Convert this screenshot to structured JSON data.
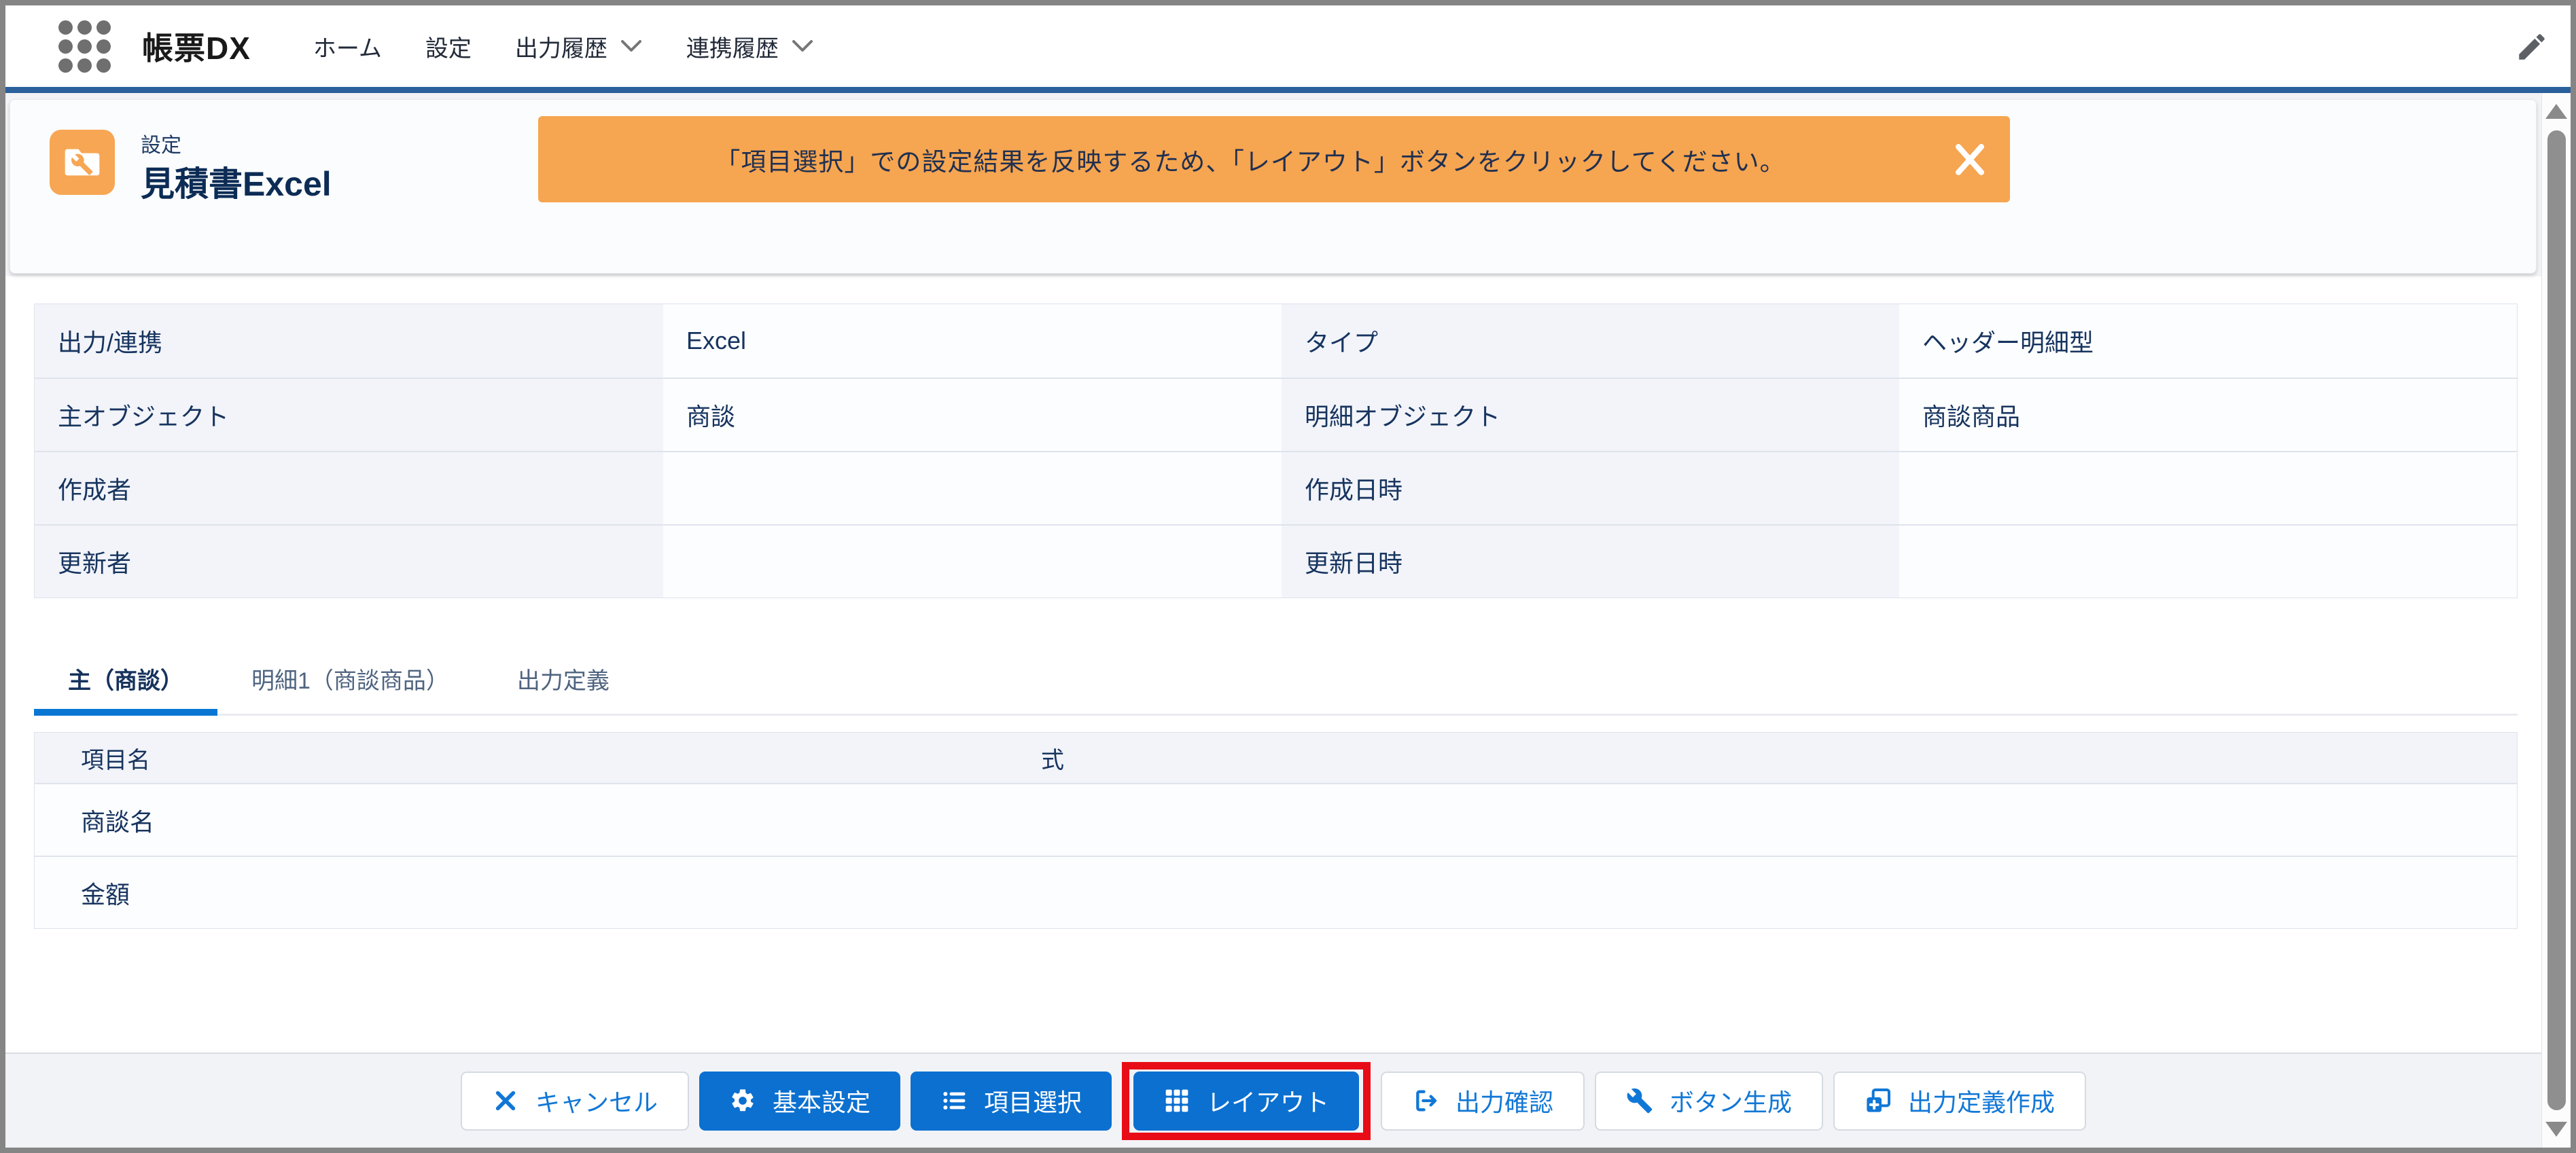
{
  "app_header": {
    "app_name": "帳票DX",
    "nav_items": [
      {
        "label": "ホーム",
        "has_menu": false
      },
      {
        "label": "設定",
        "has_menu": false
      },
      {
        "label": "出力履歴",
        "has_menu": true
      },
      {
        "label": "連携履歴",
        "has_menu": true
      }
    ]
  },
  "page_header": {
    "record_type_label": "設定",
    "title": "見積書Excel",
    "banner": {
      "message": "「項目選択」での設定結果を反映するため、「レイアウト」ボタンをクリックしてください。"
    }
  },
  "record_details": {
    "fields": [
      {
        "label": "出力/連携",
        "value": "Excel"
      },
      {
        "label": "タイプ",
        "value": "ヘッダー明細型"
      },
      {
        "label": "主オブジェクト",
        "value": "商談"
      },
      {
        "label": "明細オブジェクト",
        "value": "商談商品"
      },
      {
        "label": "作成者",
        "value": ""
      },
      {
        "label": "作成日時",
        "value": ""
      },
      {
        "label": "更新者",
        "value": ""
      },
      {
        "label": "更新日時",
        "value": ""
      }
    ]
  },
  "tabs": [
    {
      "label": "主（商談）",
      "active": true
    },
    {
      "label": "明細1（商談商品）",
      "active": false
    },
    {
      "label": "出力定義",
      "active": false
    }
  ],
  "field_table": {
    "columns": [
      "項目名",
      "式"
    ],
    "rows": [
      {
        "name": "商談名",
        "formula": ""
      },
      {
        "name": "金額",
        "formula": ""
      }
    ]
  },
  "footer": {
    "buttons": [
      {
        "label": "キャンセル",
        "variant": "neutral",
        "icon": "close-icon",
        "highlighted": false
      },
      {
        "label": "基本設定",
        "variant": "brand",
        "icon": "gear-icon",
        "highlighted": false
      },
      {
        "label": "項目選択",
        "variant": "brand",
        "icon": "bulleted-list-icon",
        "highlighted": false
      },
      {
        "label": "レイアウト",
        "variant": "brand",
        "icon": "grid-icon",
        "highlighted": true
      },
      {
        "label": "出力確認",
        "variant": "neutral",
        "icon": "export-icon",
        "highlighted": false
      },
      {
        "label": "ボタン生成",
        "variant": "neutral",
        "icon": "wrench-icon",
        "highlighted": false
      },
      {
        "label": "出力定義作成",
        "variant": "neutral",
        "icon": "add-definition-icon",
        "highlighted": false
      }
    ]
  },
  "colors": {
    "brand_blue": "#0b70d0",
    "accent_line": "#2a609c",
    "banner_orange": "#f6a551",
    "tile_orange": "#f7a654",
    "highlight_red": "#e80c16",
    "title_navy": "#0c2c55",
    "cell_label_bg": "#f2f4f9"
  }
}
